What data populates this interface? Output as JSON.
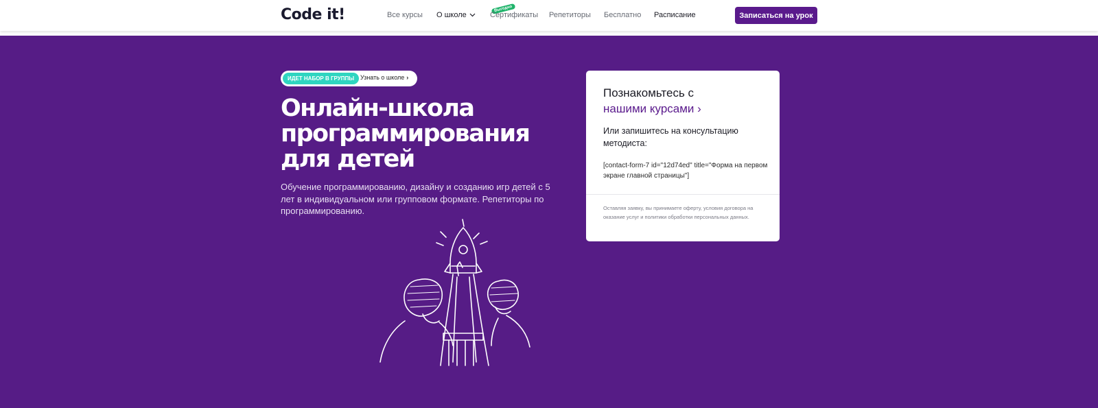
{
  "header": {
    "logo": "Code it!",
    "nav": [
      {
        "label": "Все курсы"
      },
      {
        "label": "О школе"
      },
      {
        "label": "Сертификаты",
        "badge": "Выгодно"
      },
      {
        "label": "Репетиторы"
      },
      {
        "label": "Бесплатно"
      },
      {
        "label": "Расписание"
      }
    ],
    "cta": "Записаться на урок"
  },
  "hero": {
    "pill_tag": "ИДЕТ НАБОР В ГРУППЫ",
    "pill_link": "Узнать о школе",
    "title": "Онлайн-школа программирования для детей",
    "description": "Обучение программированию, дизайну и созданию игр детей с 5 лет в индивидуальном или групповом формате. Репетиторы по программированию."
  },
  "card": {
    "title_line1": "Познакомьтесь с",
    "title_link": "нашими курсами ›",
    "subtitle": "Или запишитесь на консультацию методиста:",
    "shortcode": "[contact-form-7 id=\"12d74ed\" title=\"Форма на первом экране главной страницы\"]",
    "legal": "Оставляя заявку, вы принимаете оферту, условия договора на оказание услуг и политики обработки персональных данных."
  },
  "colors": {
    "brand_purple": "#5a1a8c",
    "hero_bg": "#561c86",
    "accent_teal": "#2fd5c0",
    "badge_green": "#1fb36a"
  },
  "icons": [
    "chevron-down-icon",
    "chevron-right-icon",
    "rocket-kids-illustration"
  ]
}
